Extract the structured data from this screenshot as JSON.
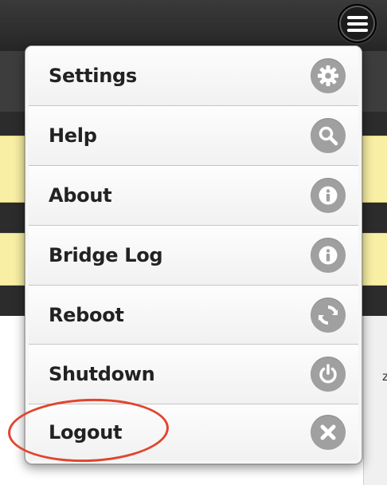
{
  "header": {
    "menu_button_icon": "hamburger-icon"
  },
  "menu": {
    "items": [
      {
        "label": "Settings",
        "icon": "gear-icon"
      },
      {
        "label": "Help",
        "icon": "search-icon"
      },
      {
        "label": "About",
        "icon": "info-icon"
      },
      {
        "label": "Bridge Log",
        "icon": "info-icon"
      },
      {
        "label": "Reboot",
        "icon": "refresh-icon"
      },
      {
        "label": "Shutdown",
        "icon": "power-icon"
      },
      {
        "label": "Logout",
        "icon": "close-icon"
      }
    ]
  },
  "background": {
    "edge_text": "z"
  },
  "annotation": {
    "target": "Logout",
    "color": "#e0452e"
  },
  "colors": {
    "topbar": "#2e2e2e",
    "highlight_rows": "#f8efa4",
    "icon_circle": "#a0a0a0",
    "label_text": "#222222"
  }
}
